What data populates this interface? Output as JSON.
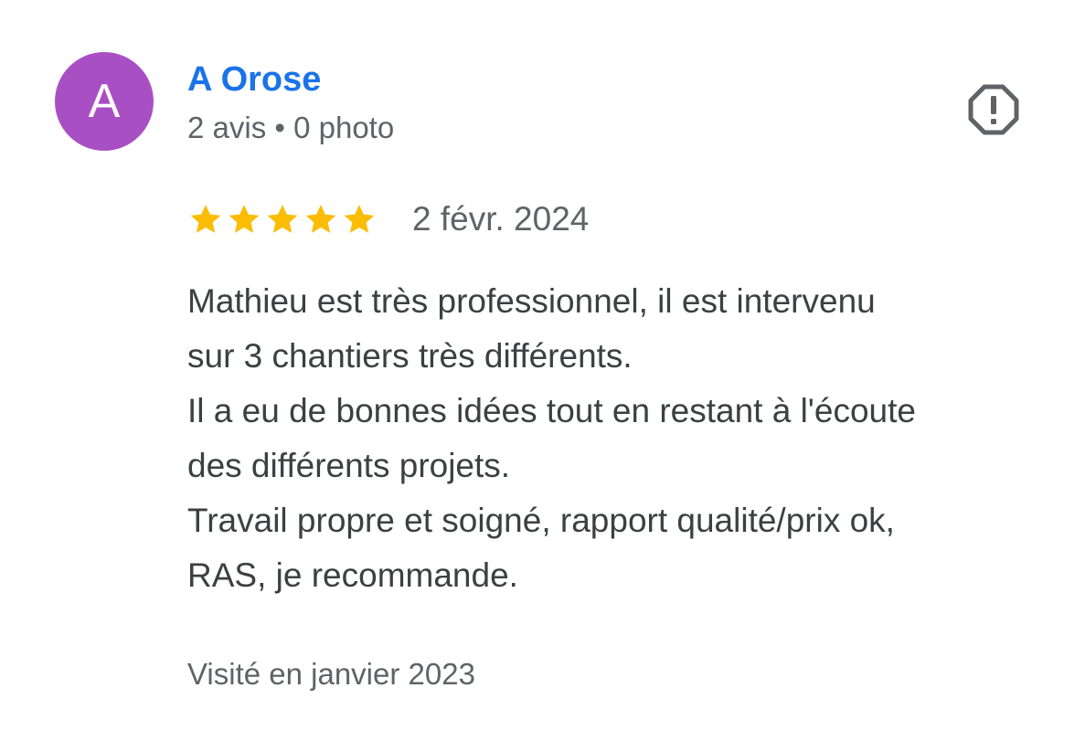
{
  "reviewer": {
    "avatar_letter": "A",
    "avatar_color": "#a94fc4",
    "name": "A Orose",
    "meta": "2 avis • 0 photo"
  },
  "report": {
    "icon": "report-flag-icon"
  },
  "review": {
    "rating": 5,
    "max_rating": 5,
    "star_color": "#fbbc04",
    "date": "2 févr. 2024",
    "lines": [
      "Mathieu est très professionnel, il est intervenu",
      "sur 3 chantiers très différents.",
      "Il a eu de bonnes idées tout en restant à l'écoute",
      "des différents projets.",
      "Travail propre et soigné, rapport qualité/prix ok,",
      "RAS, je recommande."
    ],
    "visited": "Visité en janvier 2023"
  },
  "colors": {
    "name": "#1a73e8",
    "secondary_text": "#5f6368",
    "body_text": "#3c4043"
  }
}
